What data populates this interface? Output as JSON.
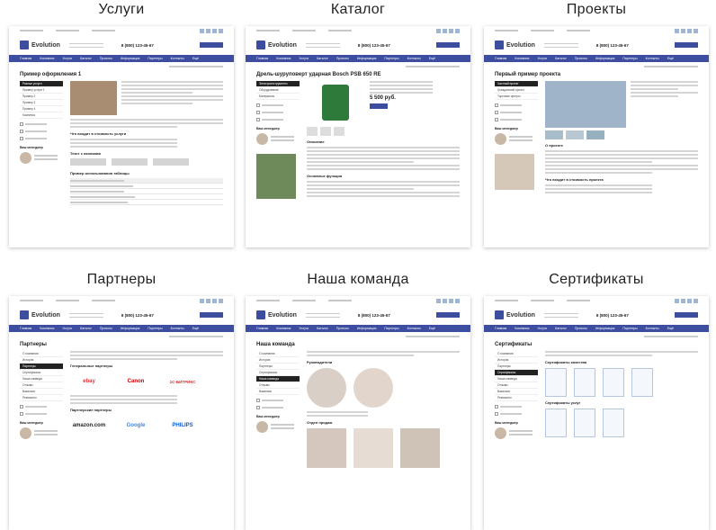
{
  "panels": [
    {
      "title": "Услуги"
    },
    {
      "title": "Каталог"
    },
    {
      "title": "Проекты"
    },
    {
      "title": "Партнеры"
    },
    {
      "title": "Наша команда"
    },
    {
      "title": "Сертификаты"
    }
  ],
  "thumbs": {
    "brand": "Evolution",
    "phone": "8 (800) 123-45-67",
    "nav": [
      "Главная",
      "Компания",
      "Услуги",
      "Каталог",
      "Проекты",
      "Информация",
      "Партнеры",
      "Контакты",
      "Ещё"
    ],
    "services": {
      "heading": "Пример оформления 1",
      "side": [
        "Разные услуги",
        "Пример услуги 1",
        "Пример 2",
        "Пример 3",
        "Пример 4",
        "Комплекс"
      ],
      "sub1": "Что входит в стоимость услуги",
      "sub2": "Текст с иконками",
      "sub3": "Пример использования таблицы",
      "manager": "Ваш менеджер"
    },
    "catalog": {
      "heading": "Дрель-шуруповерт ударная Bosch PSB 650 RE",
      "side": [
        "Электроинструменты",
        "Оборудование",
        "Материалы"
      ],
      "price": "5 500 руб.",
      "sub1": "Описание",
      "sub2": "Основные функции",
      "manager": "Ваш менеджер"
    },
    "projects": {
      "heading": "Первый пример проекта",
      "side": [
        "Частный проект",
        "Гражданский проект",
        "Торговые центры"
      ],
      "sub1": "О проекте",
      "sub2": "Что входит в стоимость проекта",
      "manager": "Ваш менеджер"
    },
    "partners": {
      "heading": "Партнеры",
      "side": [
        "О компании",
        "История",
        "Партнеры",
        "Сертификаты",
        "Наша команда",
        "Отзывы",
        "Вакансии",
        "Реквизиты"
      ],
      "sub1": "Генеральные партнеры",
      "sub2": "Партнерские партнеры",
      "logos": [
        "ebay",
        "Canon",
        "1С-БИТРИКС"
      ],
      "logos2": [
        "amazon.com",
        "Google",
        "PHILIPS"
      ],
      "manager": "Ваш менеджер"
    },
    "team": {
      "heading": "Наша команда",
      "side": [
        "О компании",
        "История",
        "Партнеры",
        "Сертификаты",
        "Наша команда",
        "Отзывы",
        "Вакансии"
      ],
      "sub1": "Руководители",
      "sub2": "Отдел продаж",
      "manager": "Ваш менеджер"
    },
    "certs": {
      "heading": "Сертификаты",
      "side": [
        "О компании",
        "История",
        "Партнеры",
        "Сертификаты",
        "Наша команда",
        "Отзывы",
        "Вакансии",
        "Реквизиты"
      ],
      "sub1": "Сертификаты качества",
      "sub2": "Сертификаты услуг",
      "manager": "Ваш менеджер"
    }
  }
}
